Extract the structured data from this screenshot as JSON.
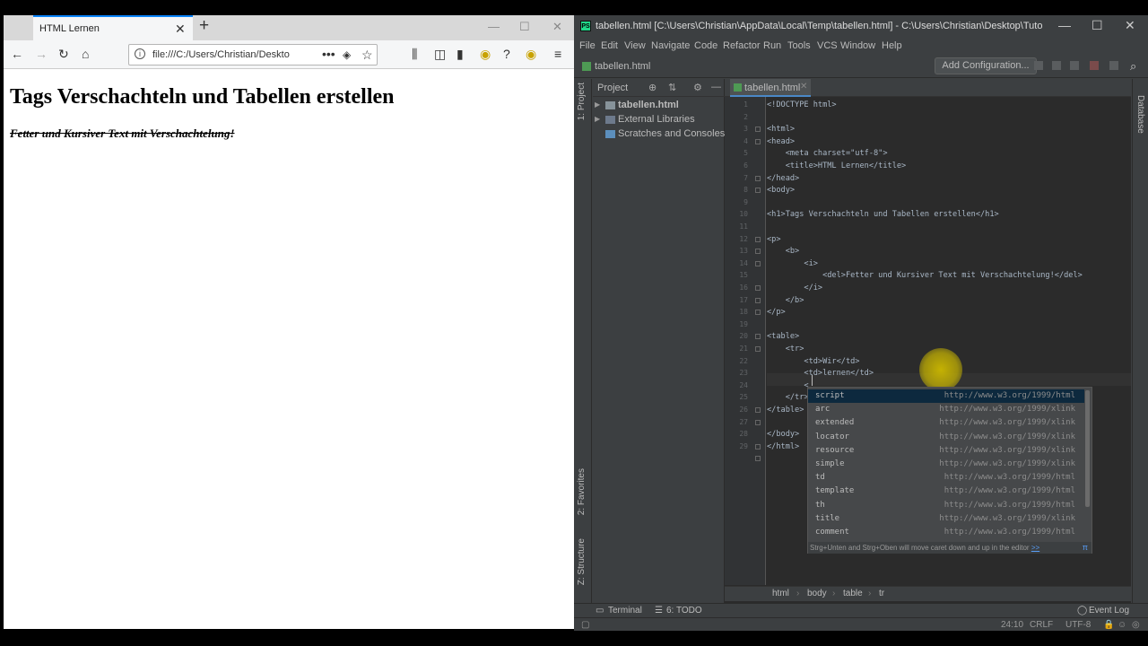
{
  "browser": {
    "tab_title": "HTML Lernen",
    "url": "file:///C:/Users/Christian/Desktop/Tutorial/tabellen.html",
    "url_visible": "file:///C:/Users/Christian/Deskto",
    "heading": "Tags Verschachteln und Tabellen erstellen",
    "paragraph": "Fetter und Kursiver Text mit Verschachtelung!"
  },
  "ide": {
    "window_title": "tabellen.html [C:\\Users\\Christian\\AppData\\Local\\Temp\\tabellen.html] - C:\\Users\\Christian\\Desktop\\Tutorial\\tabellen...",
    "menu": [
      "File",
      "Edit",
      "View",
      "Navigate",
      "Code",
      "Refactor",
      "Run",
      "Tools",
      "VCS",
      "Window",
      "Help"
    ],
    "nav_file": "tabellen.html",
    "add_config": "Add Configuration...",
    "project_label": "Project",
    "project_tree": [
      "tabellen.html",
      "External Libraries",
      "Scratches and Consoles"
    ],
    "editor_tab": "tabellen.html",
    "left_tabs": [
      "1: Project",
      "2: Favorites",
      "Z: Structure"
    ],
    "right_tab": "Database",
    "code_lines": [
      "<!DOCTYPE html>",
      "",
      "<html>",
      "<head>",
      "    <meta charset=\"utf-8\">",
      "    <title>HTML Lernen</title>",
      "</head>",
      "<body>",
      "",
      "<h1>Tags Verschachteln und Tabellen erstellen</h1>",
      "",
      "<p>",
      "    <b>",
      "        <i>",
      "            <del>Fetter und Kursiver Text mit Verschachtelung!</del>",
      "        </i>",
      "    </b>",
      "</p>",
      "",
      "<table>",
      "    <tr>",
      "        <td>Wir</td>",
      "        <td>lernen</td>",
      "        <",
      "",
      "    </tr>",
      "</table>",
      "",
      "</body>",
      "</html>"
    ],
    "line_numbers": [
      "1",
      "2",
      "3",
      "4",
      "5",
      "6",
      "7",
      "8",
      "9",
      "10",
      "11",
      "12",
      "13",
      "14",
      "15",
      "16",
      "17",
      "18",
      "19",
      "20",
      "21",
      "22",
      "23",
      "24",
      "25",
      "26",
      "27",
      "28",
      "29"
    ],
    "completion": [
      {
        "name": "script",
        "ns": "http://www.w3.org/1999/html"
      },
      {
        "name": "arc",
        "ns": "http://www.w3.org/1999/xlink"
      },
      {
        "name": "extended",
        "ns": "http://www.w3.org/1999/xlink"
      },
      {
        "name": "locator",
        "ns": "http://www.w3.org/1999/xlink"
      },
      {
        "name": "resource",
        "ns": "http://www.w3.org/1999/xlink"
      },
      {
        "name": "simple",
        "ns": "http://www.w3.org/1999/xlink"
      },
      {
        "name": "td",
        "ns": "http://www.w3.org/1999/html"
      },
      {
        "name": "template",
        "ns": "http://www.w3.org/1999/html"
      },
      {
        "name": "th",
        "ns": "http://www.w3.org/1999/html"
      },
      {
        "name": "title",
        "ns": "http://www.w3.org/1999/xlink"
      },
      {
        "name": "comment",
        "ns": "http://www.w3.org/1999/html"
      }
    ],
    "completion_hint": "Strg+Unten and Strg+Oben will move caret down and up in the editor",
    "completion_hint_link": ">>",
    "completion_pi": "π",
    "breadcrumbs": [
      "html",
      "body",
      "table",
      "tr"
    ],
    "bottom_tools": {
      "terminal": "Terminal",
      "todo": "6: TODO",
      "event_log": "Event Log"
    },
    "status": {
      "position": "24:10",
      "line_sep": "CRLF",
      "encoding": "UTF-8"
    }
  }
}
